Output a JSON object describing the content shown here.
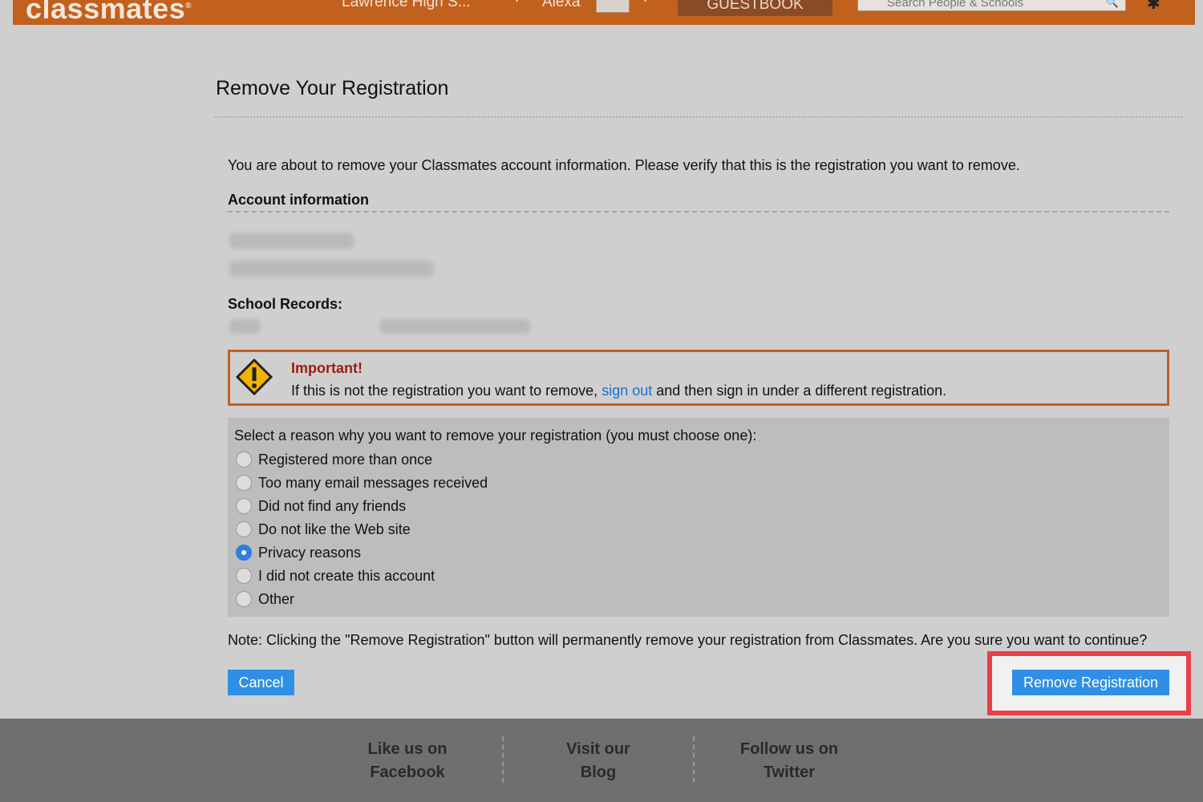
{
  "header": {
    "logo": "classmates",
    "school": "Lawrence High S...",
    "user": "Alexa",
    "guestbook": "GUESTBOOK",
    "search_placeholder": "Search People & Schools"
  },
  "main": {
    "title": "Remove Your Registration",
    "intro": "You are about to remove your Classmates account information. Please verify that this is the registration you want to remove.",
    "account_heading": "Account information",
    "records_heading": "School Records:",
    "important": {
      "title": "Important!",
      "text_before": "If this is not the registration you want to remove,",
      "link": "sign out",
      "text_after": "and then sign in under a different registration."
    },
    "reasons": {
      "question": "Select a reason why you want to remove your registration (you must choose one):",
      "options": [
        "Registered more than once",
        "Too many email messages received",
        "Did not find any friends",
        "Do not like the Web site",
        "Privacy reasons",
        "I did not create this account",
        "Other"
      ],
      "selected": "Privacy reasons"
    },
    "note": "Note: Clicking the \"Remove Registration\" button will permanently remove your registration from Classmates. Are you sure you want to continue?",
    "cancel_label": "Cancel",
    "remove_label": "Remove Registration"
  },
  "footer": {
    "facebook_line1": "Like us on",
    "facebook_line2": "Facebook",
    "blog_line1": "Visit our",
    "blog_line2": "Blog",
    "twitter_line1": "Follow us on",
    "twitter_line2": "Twitter"
  },
  "colors": {
    "brand_orange": "#c2601e",
    "button_blue": "#2f8fe6",
    "highlight_red": "#e8404a",
    "important_red": "#9b1c0e"
  }
}
